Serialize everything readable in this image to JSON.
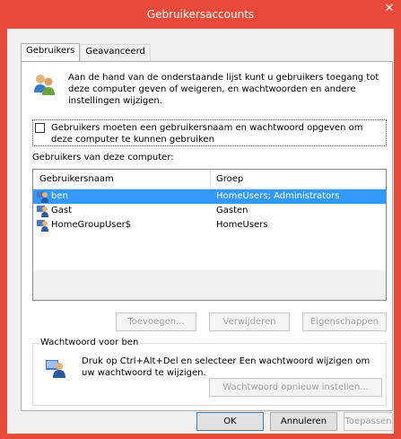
{
  "window": {
    "title": "Gebruikersaccounts",
    "close_glyph": "✕"
  },
  "tabs": [
    {
      "label": "Gebruikers"
    },
    {
      "label": "Geavanceerd"
    }
  ],
  "intro_text": "Aan de hand van de onderstaande lijst kunt u gebruikers toegang tot deze computer geven of weigeren, en wachtwoorden en andere instellingen wijzigen.",
  "require_password": {
    "label": "Gebruikers moeten een gebruikersnaam en wachtwoord opgeven om deze computer te kunnen gebruiken",
    "checked": false
  },
  "users_list": {
    "label": "Gebruikers van deze computer:",
    "columns": [
      "Gebruikersnaam",
      "Groep"
    ],
    "rows": [
      {
        "name": "ben",
        "group": "HomeUsers; Administrators",
        "selected": true
      },
      {
        "name": "Gast",
        "group": "Gasten",
        "selected": false
      },
      {
        "name": "HomeGroupUser$",
        "group": "HomeUsers",
        "selected": false
      }
    ]
  },
  "list_buttons": {
    "add": "Toevoegen...",
    "remove": "Verwijderen",
    "properties": "Eigenschappen"
  },
  "password_group": {
    "title": "Wachtwoord voor ben",
    "text": "Druk op Ctrl+Alt+Del en selecteer Een wachtwoord wijzigen om uw wachtwoord te wijzigen.",
    "reset_button": "Wachtwoord opnieuw instellen..."
  },
  "footer": {
    "ok": "OK",
    "cancel": "Annuleren",
    "apply": "Toepassen"
  },
  "colors": {
    "title_bar": "#e84a3a",
    "selection": "#3399ff"
  }
}
